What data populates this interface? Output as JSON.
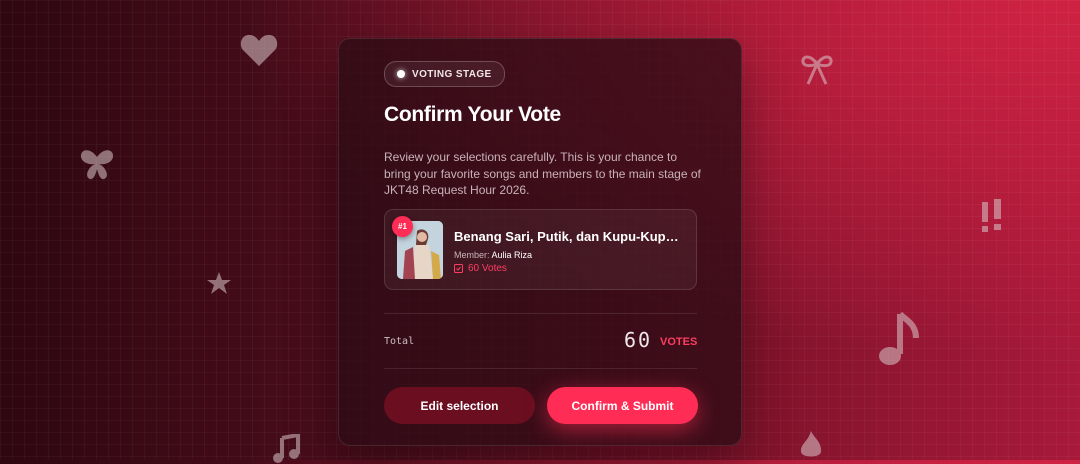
{
  "badge": {
    "label": "VOTING STAGE"
  },
  "title": "Confirm Your Vote",
  "description": "Review your selections carefully. This is your chance to bring your favorite songs and members to the main stage of JKT48 Request Hour 2026.",
  "selection": {
    "rank": "#1",
    "song_title": "Benang Sari, Putik, dan Kupu-Kupu ...",
    "member_label": "Member:",
    "member_name": "Aulia Riza",
    "votes": "60 Votes"
  },
  "total": {
    "label": "Total",
    "value": "60",
    "unit": "VOTES"
  },
  "actions": {
    "edit_label": "Edit selection",
    "confirm_label": "Confirm & Submit"
  },
  "colors": {
    "accent": "#ff2d55",
    "card_bg": "#2d0c14",
    "edit_button": "#6a0e20"
  },
  "decorations": [
    "heart-icon",
    "butterfly-icon",
    "star-icon",
    "music-note-icon",
    "ribbon-icon",
    "exclamation-icon",
    "flame-icon"
  ]
}
